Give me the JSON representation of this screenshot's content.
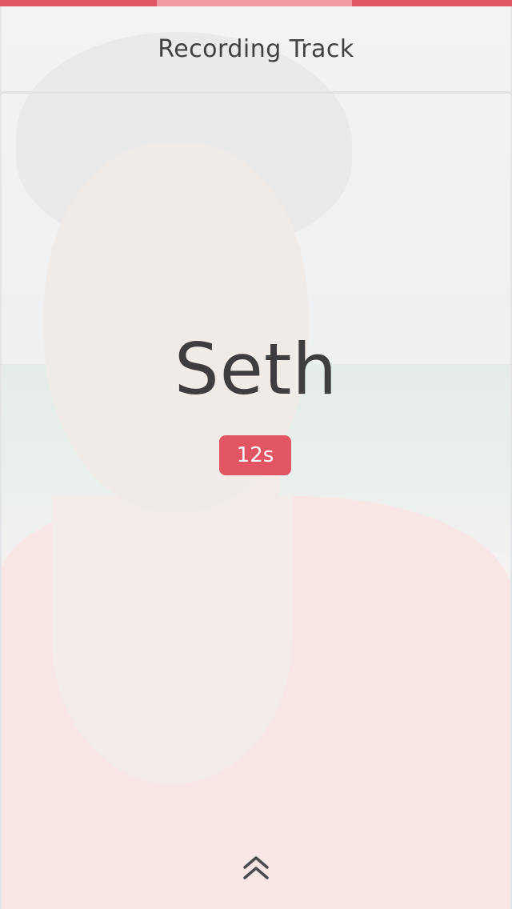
{
  "header": {
    "title": "Recording Track"
  },
  "progress": {
    "segments": 3,
    "active_segment": 2,
    "color_active": "#e25663",
    "color_current": "#f29aa1"
  },
  "recording": {
    "name": "Seth",
    "elapsed": "12s"
  },
  "controls": {
    "expand_icon": "double-chevron-up-icon"
  },
  "colors": {
    "accent": "#e25663",
    "text": "#3e3e40"
  }
}
